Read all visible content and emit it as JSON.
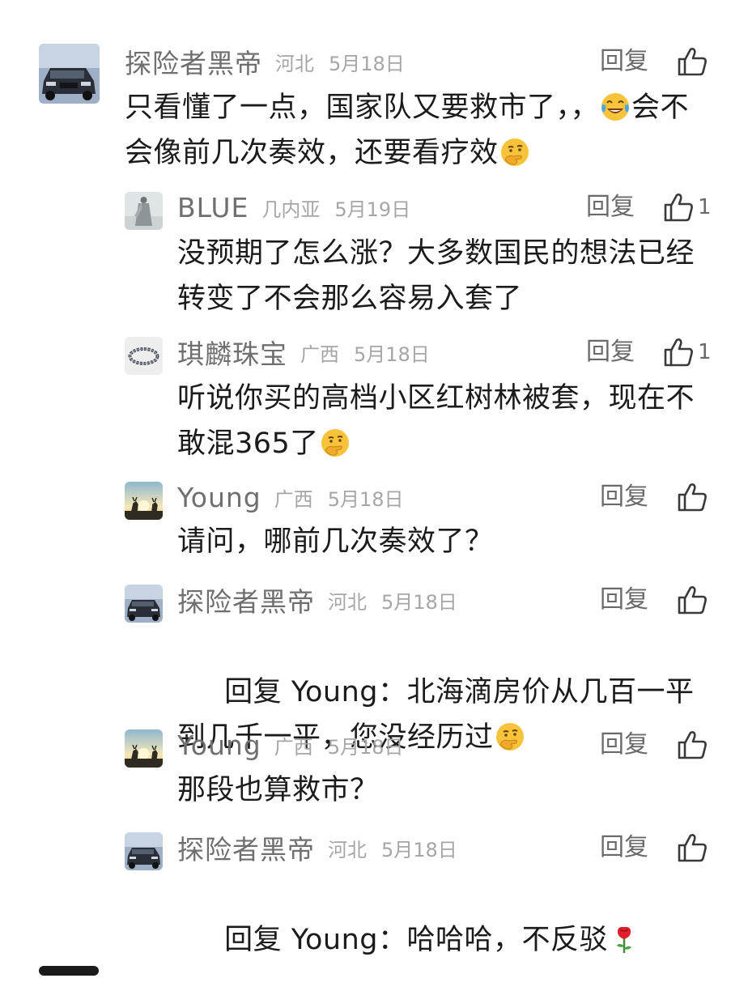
{
  "comments": [
    {
      "user": "探险者黑帝",
      "location": "河北",
      "date": "5月18日",
      "reply_label": "回复",
      "likes": "",
      "segments": [
        {
          "t": "只看懂了一点，国家队又要救市了，，"
        },
        {
          "e": "tears-of-joy-emoji"
        },
        {
          "t": "会不会像前几次奏效，还要看疗效"
        },
        {
          "e": "thinking-hand-emoji"
        }
      ]
    },
    {
      "user": "BLUE",
      "location": "几内亚",
      "date": "5月19日",
      "reply_label": "回复",
      "likes": "1",
      "segments": [
        {
          "t": "没预期了怎么涨？大多数国民的想法已经转变了不会那么容易入套了"
        }
      ]
    },
    {
      "user": "琪麟珠宝",
      "location": "广西",
      "date": "5月18日",
      "reply_label": "回复",
      "likes": "1",
      "segments": [
        {
          "t": "听说你买的高档小区红树林被套，现在不敢混365了"
        },
        {
          "e": "thinking-hand-emoji"
        }
      ]
    },
    {
      "user": "Young",
      "location": "广西",
      "date": "5月18日",
      "reply_label": "回复",
      "likes": "",
      "segments": [
        {
          "t": "请问，哪前几次奏效了？"
        }
      ]
    },
    {
      "user": "探险者黑帝",
      "location": "河北",
      "date": "5月18日",
      "reply_label": "回复",
      "likes": "",
      "segments": [
        {
          "t": " 回复 Young：北海滴房价从几百一平到几千一平，您没经历过"
        },
        {
          "e": "thinking-hand-emoji"
        }
      ]
    },
    {
      "user": "Young",
      "location": "广西",
      "date": "5月18日",
      "reply_label": "回复",
      "likes": "",
      "segments": [
        {
          "t": "那段也算救市？"
        }
      ]
    },
    {
      "user": "探险者黑帝",
      "location": "河北",
      "date": "5月18日",
      "reply_label": "回复",
      "likes": "",
      "segments": [
        {
          "t": " 回复 Young：哈哈哈，不反驳"
        },
        {
          "e": "rose-emoji"
        }
      ]
    }
  ]
}
